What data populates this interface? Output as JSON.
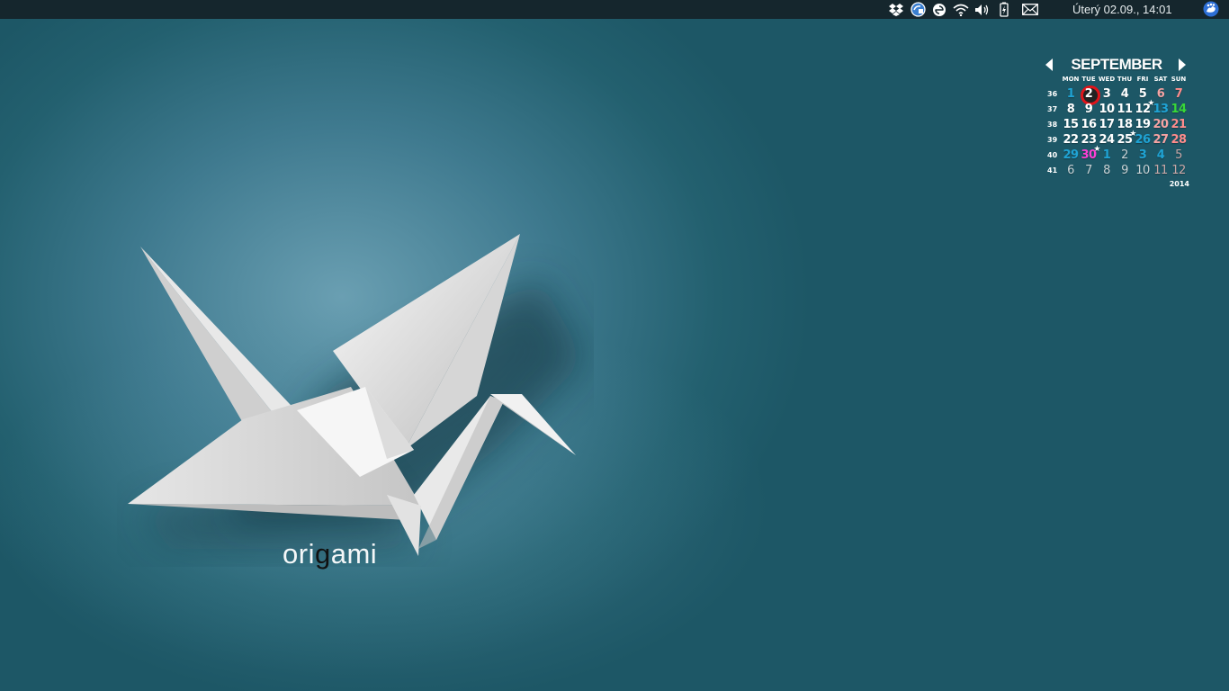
{
  "panel": {
    "clock": "Úterý 02.09., 14:01",
    "tray_icons": [
      "dropbox-icon",
      "update-icon",
      "sync-icon",
      "wifi-icon",
      "volume-icon",
      "battery-icon",
      "mail-icon"
    ]
  },
  "wallpaper": {
    "brand_prefix": "ori",
    "brand_mid": "g",
    "brand_suffix": "ami"
  },
  "calendar": {
    "month": "SEPTEMBER",
    "year": "2014",
    "weekdays": [
      "MON",
      "TUE",
      "WED",
      "THU",
      "FRI",
      "SAT",
      "SUN"
    ],
    "weeks": [
      {
        "wk": "36",
        "days": [
          "1",
          "2",
          "3",
          "4",
          "5",
          "6",
          "7"
        ]
      },
      {
        "wk": "37",
        "days": [
          "8",
          "9",
          "10",
          "11",
          "12",
          "13",
          "14"
        ]
      },
      {
        "wk": "38",
        "days": [
          "15",
          "16",
          "17",
          "18",
          "19",
          "20",
          "21"
        ]
      },
      {
        "wk": "39",
        "days": [
          "22",
          "23",
          "24",
          "25",
          "26",
          "27",
          "28"
        ]
      },
      {
        "wk": "40",
        "days": [
          "29",
          "30",
          "1",
          "2",
          "3",
          "4",
          "5"
        ]
      },
      {
        "wk": "41",
        "days": [
          "6",
          "7",
          "8",
          "9",
          "10",
          "11",
          "12"
        ]
      }
    ],
    "today": "2",
    "colors": {
      "today_ring": "#e0141a",
      "other": "#1fa3d4",
      "weekend": "#ff8c8c",
      "green": "#38d838",
      "magenta": "#ff3fd5"
    }
  }
}
